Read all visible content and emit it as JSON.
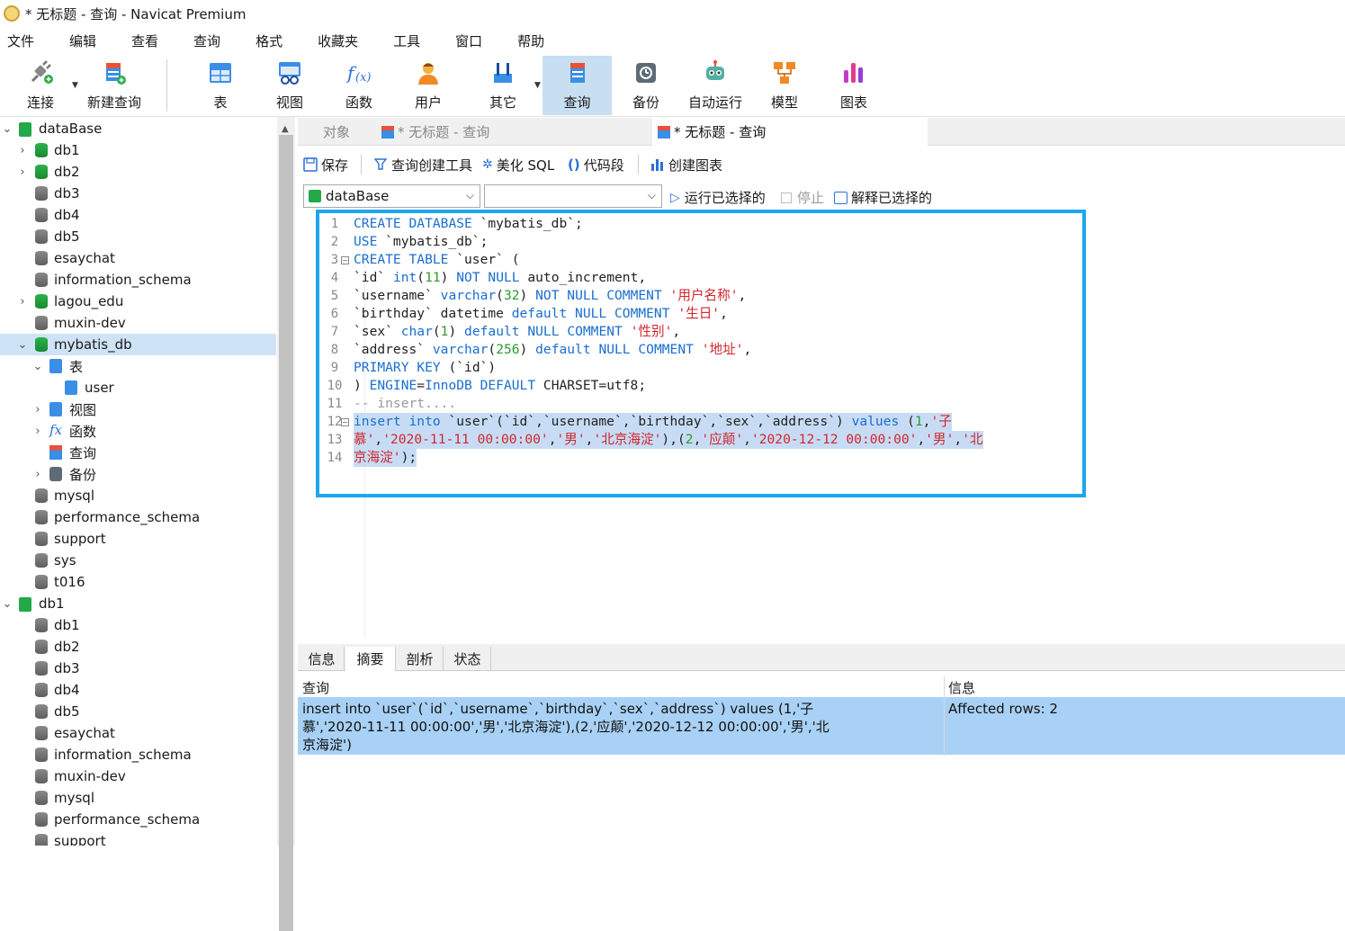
{
  "window": {
    "title": "* 无标题 - 查询 - Navicat Premium"
  },
  "menu": [
    "文件",
    "编辑",
    "查看",
    "查询",
    "格式",
    "收藏夹",
    "工具",
    "窗口",
    "帮助"
  ],
  "toolbar": {
    "connect": "连接",
    "new_query": "新建查询",
    "table": "表",
    "view": "视图",
    "function": "函数",
    "user": "用户",
    "other": "其它",
    "query": "查询",
    "backup": "备份",
    "auto_run": "自动运行",
    "model": "模型",
    "chart": "图表"
  },
  "sidebar": {
    "conn1": "dataBase",
    "dbs1": [
      "db1",
      "db2",
      "db3",
      "db4",
      "db5",
      "esaychat",
      "information_schema",
      "lagou_edu",
      "muxin-dev",
      "mybatis_db"
    ],
    "node_table": "表",
    "node_user": "user",
    "node_view": "视图",
    "node_func": "函数",
    "node_query": "查询",
    "node_backup": "备份",
    "dbs1b": [
      "mysql",
      "performance_schema",
      "support",
      "sys",
      "t016"
    ],
    "conn2": "db1",
    "dbs2": [
      "db1",
      "db2",
      "db3",
      "db4",
      "db5",
      "esaychat",
      "information_schema",
      "muxin-dev",
      "mysql",
      "performance_schema",
      "support"
    ]
  },
  "tabs": {
    "objects": "对象",
    "tab1": "* 无标题 - 查询",
    "tab2": "* 无标题 - 查询"
  },
  "qtoolbar": {
    "save": "保存",
    "builder": "查询创建工具",
    "beautify": "美化 SQL",
    "snippet": "代码段",
    "create_chart": "创建图表",
    "run_selected": "运行已选择的",
    "stop": "停止",
    "explain_selected": "解释已选择的"
  },
  "selectors": {
    "database": "dataBase",
    "schema": ""
  },
  "editor": {
    "line_numbers": [
      "1",
      "2",
      "3",
      "4",
      "5",
      "6",
      "7",
      "8",
      "9",
      "10",
      "11",
      "12",
      "13",
      "14"
    ],
    "lines": [
      "CREATE DATABASE `mybatis_db`;",
      "USE `mybatis_db`;",
      "CREATE TABLE `user` (",
      "`id` int(11) NOT NULL auto_increment,",
      "`username` varchar(32) NOT NULL COMMENT '用户名称',",
      "`birthday` datetime default NULL COMMENT '生日',",
      "`sex` char(1) default NULL COMMENT '性别',",
      "`address` varchar(256) default NULL COMMENT '地址',",
      "PRIMARY KEY (`id`)",
      ") ENGINE=InnoDB DEFAULT CHARSET=utf8;",
      "-- insert....",
      "insert into `user`(`id`,`username`,`birthday`,`sex`,`address`) values (1,'子",
      "慕','2020-11-11 00:00:00','男','北京海淀'),(2,'应颠','2020-12-12 00:00:00','男','北",
      "京海淀');"
    ]
  },
  "result": {
    "tabs": [
      "信息",
      "摘要",
      "剖析",
      "状态"
    ],
    "col_query": "查询",
    "col_info": "信息",
    "query_text": "insert into `user`(`id`,`username`,`birthday`,`sex`,`address`) values (1,'子\n慕','2020-11-11 00:00:00','男','北京海淀'),(2,'应颠','2020-12-12 00:00:00','男','北\n京海淀')",
    "info_text": "Affected rows: 2"
  },
  "colors": {
    "highlight_box": "#1ea6ee",
    "selection": "#c7dcf4",
    "result_row": "#a8d1f5",
    "keyword": "#1a6ecf",
    "string": "#d2262b",
    "number": "#2c9a2c"
  }
}
